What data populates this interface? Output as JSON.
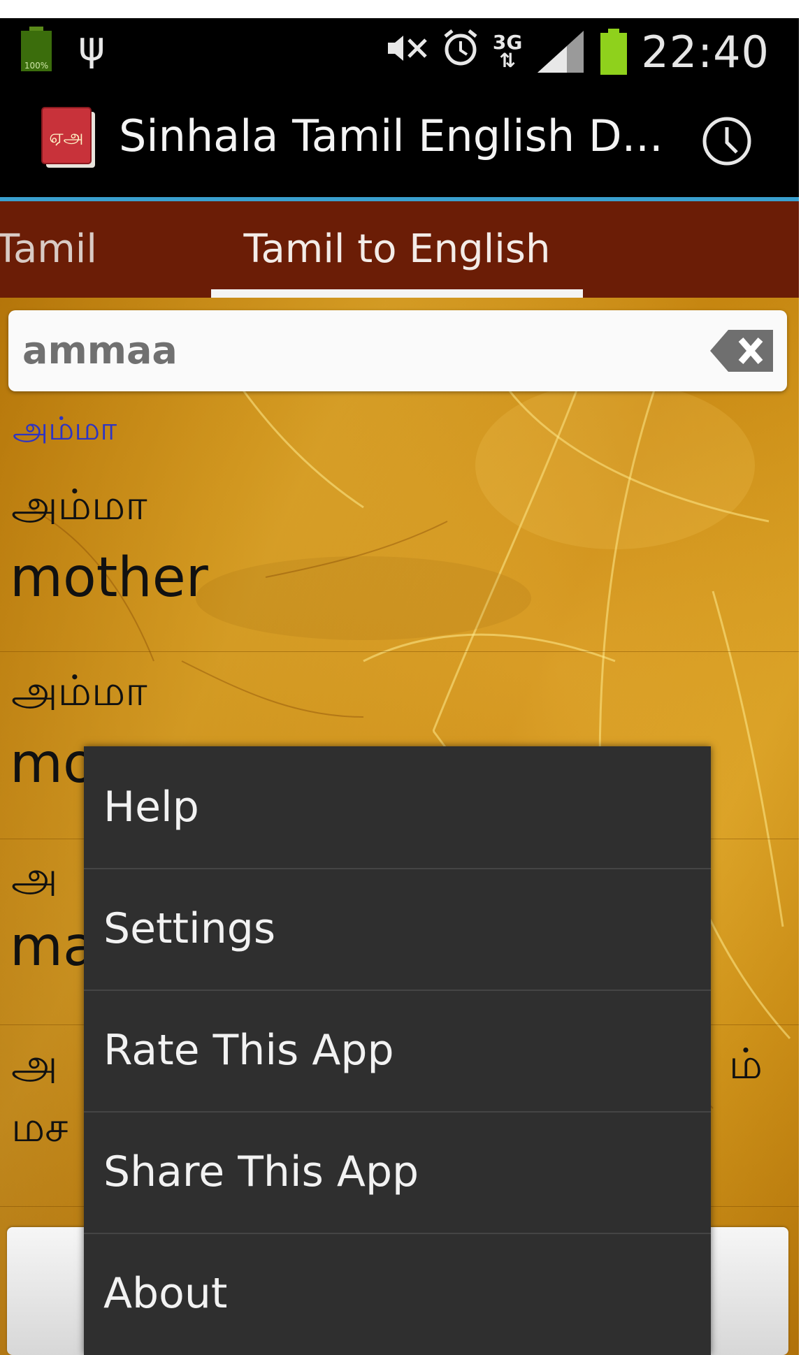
{
  "status_bar": {
    "battery_small_label": "100%",
    "network_label": "3G",
    "time": "22:40",
    "icons": [
      "battery-icon",
      "usb-icon",
      "mute-icon",
      "alarm-icon",
      "network-3g-icon",
      "signal-icon",
      "battery-icon"
    ]
  },
  "action_bar": {
    "app_icon_label": "ஏஅ",
    "title": "Sinhala Tamil English D...",
    "history_icon": "clock-icon"
  },
  "tabs": [
    {
      "label": "Tamil"
    },
    {
      "label": "Tamil to English",
      "selected": true
    }
  ],
  "search": {
    "value": "ammaa",
    "clear_icon": "backspace-clear-icon"
  },
  "suggestion": "அம்மா",
  "results": [
    {
      "tamil": "அம்மா",
      "english": "mother"
    },
    {
      "tamil": "அம்மா",
      "english": "mo"
    },
    {
      "tamil": "அ",
      "english": "ma"
    },
    {
      "tamil": "அ",
      "tail": "ம்",
      "english": "மச"
    }
  ],
  "menu": {
    "items": [
      "Help",
      "Settings",
      "Rate This App",
      "Share This App",
      "About"
    ]
  },
  "colors": {
    "status_bar": "#000000",
    "action_bar": "#000000",
    "divider": "#3aa0cf",
    "tab_bar": "#6b1d06",
    "menu_bg": "#2f2f2f",
    "suggestion_text": "#2d34c4"
  }
}
